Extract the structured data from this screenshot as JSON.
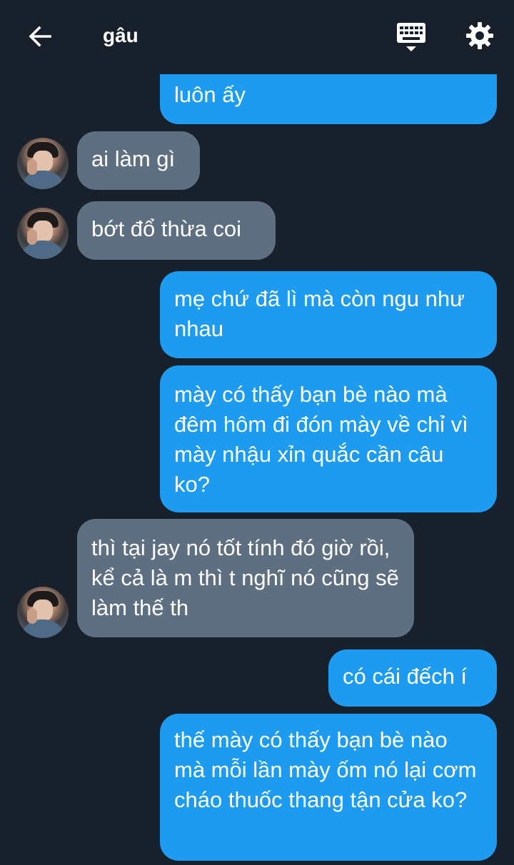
{
  "header": {
    "back_icon": "arrow-left-icon",
    "title": "gâu",
    "keyboard_icon": "keyboard-icon",
    "settings_icon": "gear-icon"
  },
  "messages": [
    {
      "from": "me",
      "text": "luôn ấy"
    },
    {
      "from": "them",
      "text": "ai làm gì"
    },
    {
      "from": "them",
      "text": "bớt đổ thừa coi"
    },
    {
      "from": "me",
      "text": "mẹ chứ đã lì mà còn ngu như nhau"
    },
    {
      "from": "me",
      "text": "mày có thấy bạn bè nào mà đêm hôm đi đón mày về chỉ vì mày nhậu xỉn quắc cần câu ko?"
    },
    {
      "from": "them",
      "text": "thì tại jay nó tốt tính đó giờ rồi, kể cả là m thì t nghĩ nó cũng sẽ làm thế th"
    },
    {
      "from": "me",
      "text": "có cái đếch í"
    },
    {
      "from": "me",
      "text": "thế mày có thấy bạn bè nào mà mỗi lần mày ốm nó lại cơm cháo thuốc thang tận cửa ko?"
    }
  ],
  "colors": {
    "background": "#18202b",
    "outgoing_bubble": "#1d9bf0",
    "incoming_bubble": "#5f6f82",
    "text": "#ffffff"
  }
}
